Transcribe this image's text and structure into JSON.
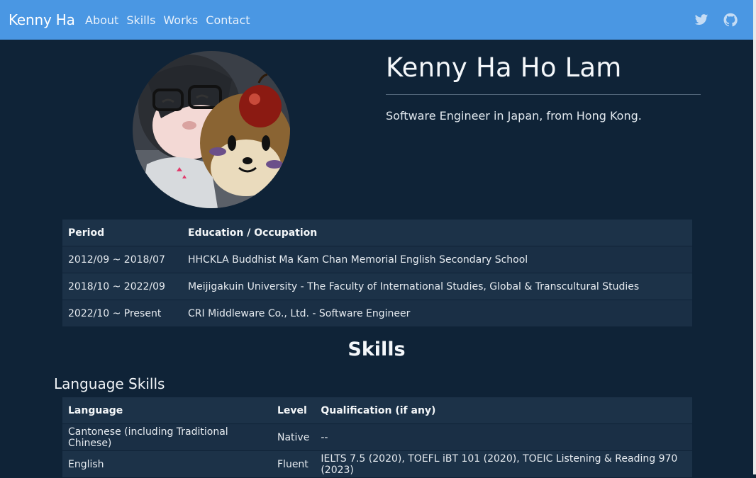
{
  "nav": {
    "brand": "Kenny Ha",
    "links": [
      "About",
      "Skills",
      "Works",
      "Contact"
    ],
    "icons": [
      "twitter-icon",
      "github-icon"
    ]
  },
  "hero": {
    "name": "Kenny Ha Ho Lam",
    "tagline": "Software Engineer in Japan, from Hong Kong."
  },
  "timeline": {
    "headers": [
      "Period",
      "Education / Occupation"
    ],
    "rows": [
      [
        "2012/09 ~ 2018/07",
        "HHCKLA Buddhist Ma Kam Chan Memorial English Secondary School"
      ],
      [
        "2018/10 ~ 2022/09",
        "Meijigakuin University - The Faculty of International Studies, Global & Transcultural Studies"
      ],
      [
        "2022/10 ~ Present",
        "CRI Middleware Co., Ltd. - Software Engineer"
      ]
    ]
  },
  "skills": {
    "title": "Skills",
    "language_title": "Language Skills",
    "language_headers": [
      "Language",
      "Level",
      "Qualification (if any)"
    ],
    "language_rows": [
      [
        "Cantonese (including Traditional Chinese)",
        "Native",
        "--"
      ],
      [
        "English",
        "Fluent",
        "IELTS 7.5 (2020), TOEFL iBT 101 (2020), TOEIC Listening & Reading 970 (2023)"
      ]
    ]
  },
  "colors": {
    "navbar": "#4a97e3",
    "background": "#0f2337",
    "table_row": "#1c3248"
  }
}
